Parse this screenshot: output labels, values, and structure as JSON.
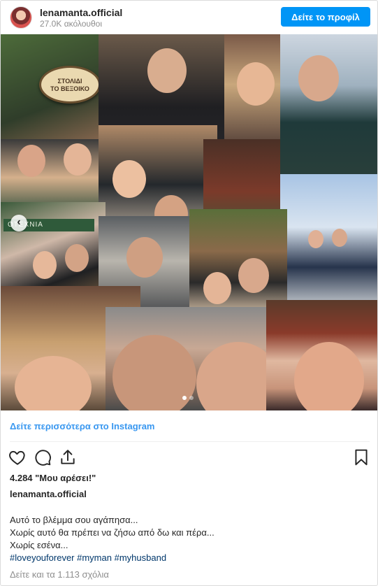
{
  "header": {
    "username": "lenamanta.official",
    "followers": "27.0K ακόλουθοι",
    "profile_button": "Δείτε το προφίλ"
  },
  "media": {
    "sign_text_1": "ΣΤΟΛΙΔΙ",
    "sign_text_2": "ΤΟ ΒΕΞΟΙΚΟ",
    "shop_sign": "ΟΤΕΧΝΙΑ",
    "nav_arrow": "‹",
    "carousel_current": 1,
    "carousel_total": 2
  },
  "footer": {
    "more_link": "Δείτε περισσότερα στο Instagram",
    "likes": "4.284 \"Μου αρέσει!\"",
    "owner": "lenamanta.official",
    "caption": [
      "Αυτό το βλέμμα σου αγάπησα...",
      "Χωρίς αυτό θα πρέπει να ζήσω από δω και πέρα...",
      "Χωρίς εσένα..."
    ],
    "hashtags": [
      "#loveyouforever",
      "#myman",
      "#myhusband"
    ],
    "comments_link": "Δείτε και τα 1.113 σχόλια"
  },
  "icons": {
    "like": "heart-icon",
    "comment": "comment-icon",
    "share": "share-icon",
    "save": "bookmark-icon"
  },
  "colors": {
    "accent": "#0095f6",
    "link": "#3897f0",
    "hashtag": "#00376b",
    "muted": "#8e8e8e"
  }
}
